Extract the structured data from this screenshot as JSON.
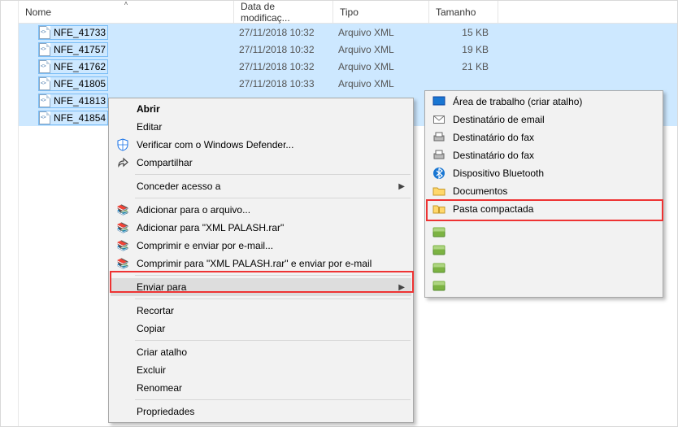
{
  "columns": {
    "name": "Nome",
    "date": "Data de modificaç...",
    "type": "Tipo",
    "size": "Tamanho"
  },
  "files": [
    {
      "name": "NFE_41733",
      "date": "27/11/2018 10:32",
      "type": "Arquivo XML",
      "size": "15 KB"
    },
    {
      "name": "NFE_41757",
      "date": "27/11/2018 10:32",
      "type": "Arquivo XML",
      "size": "19 KB"
    },
    {
      "name": "NFE_41762",
      "date": "27/11/2018 10:32",
      "type": "Arquivo XML",
      "size": "21 KB"
    },
    {
      "name": "NFE_41805",
      "date": "27/11/2018 10:33",
      "type": "Arquivo XML",
      "size": ""
    },
    {
      "name": "NFE_41813",
      "date": "",
      "type": "",
      "size": ""
    },
    {
      "name": "NFE_41854",
      "date": "",
      "type": "",
      "size": ""
    }
  ],
  "menu1": {
    "open": "Abrir",
    "edit": "Editar",
    "defender": "Verificar com o Windows Defender...",
    "share": "Compartilhar",
    "grant_access": "Conceder acesso a",
    "add_archive": "Adicionar para o arquivo...",
    "add_rar": "Adicionar para \"XML PALASH.rar\"",
    "compress_email": "Comprimir e enviar por e-mail...",
    "compress_rar_email": "Comprimir para \"XML PALASH.rar\" e enviar por e-mail",
    "send_to": "Enviar para",
    "cut": "Recortar",
    "copy": "Copiar",
    "shortcut": "Criar atalho",
    "delete": "Excluir",
    "rename": "Renomear",
    "properties": "Propriedades"
  },
  "menu2": {
    "desktop": "Área de trabalho (criar atalho)",
    "mail": "Destinatário de email",
    "fax1": "Destinatário do fax",
    "fax2": "Destinatário do fax",
    "bluetooth": "Dispositivo Bluetooth",
    "documents": "Documentos",
    "compressed": "Pasta compactada"
  }
}
